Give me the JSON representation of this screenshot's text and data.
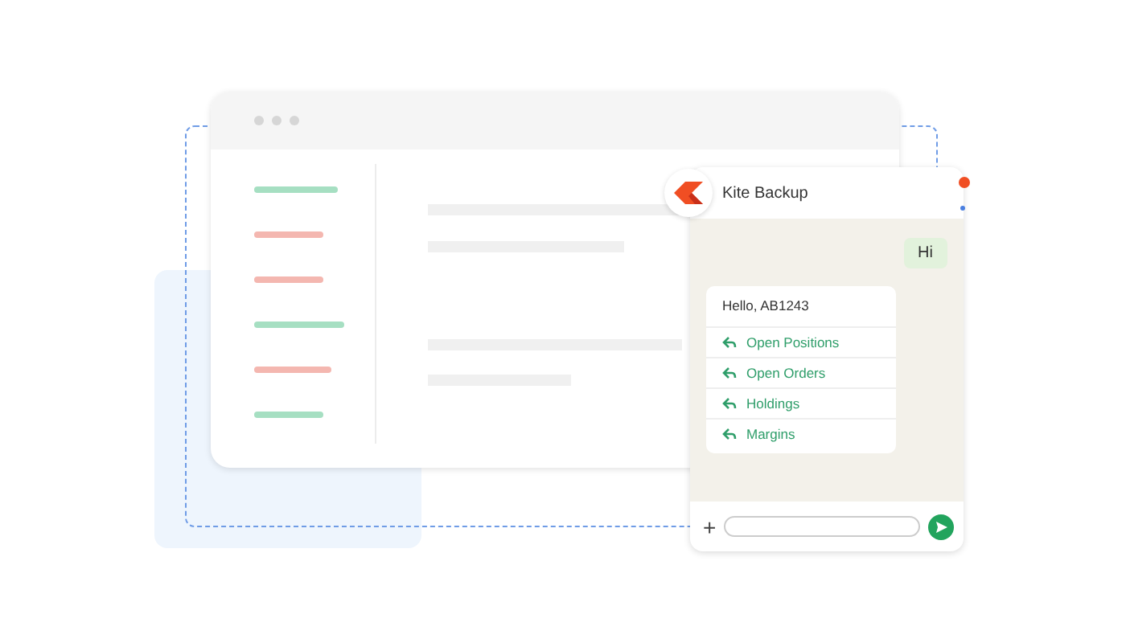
{
  "sidebar": {
    "items": [
      {
        "color": "#a6dfc2"
      },
      {
        "color": "#f4b7b0"
      },
      {
        "color": "#f4b7b0"
      },
      {
        "color": "#a6dfc2"
      },
      {
        "color": "#f4b7b0"
      },
      {
        "color": "#a6dfc2"
      }
    ]
  },
  "chat": {
    "title": "Kite Backup",
    "messages": [
      {
        "kind": "outgoing",
        "text": "Hi"
      },
      {
        "kind": "incoming",
        "text": "Hello, AB1243",
        "replies": [
          "Open Positions",
          "Open Orders",
          "Holdings",
          "Margins"
        ]
      }
    ],
    "composer": {
      "plus": "+"
    }
  }
}
